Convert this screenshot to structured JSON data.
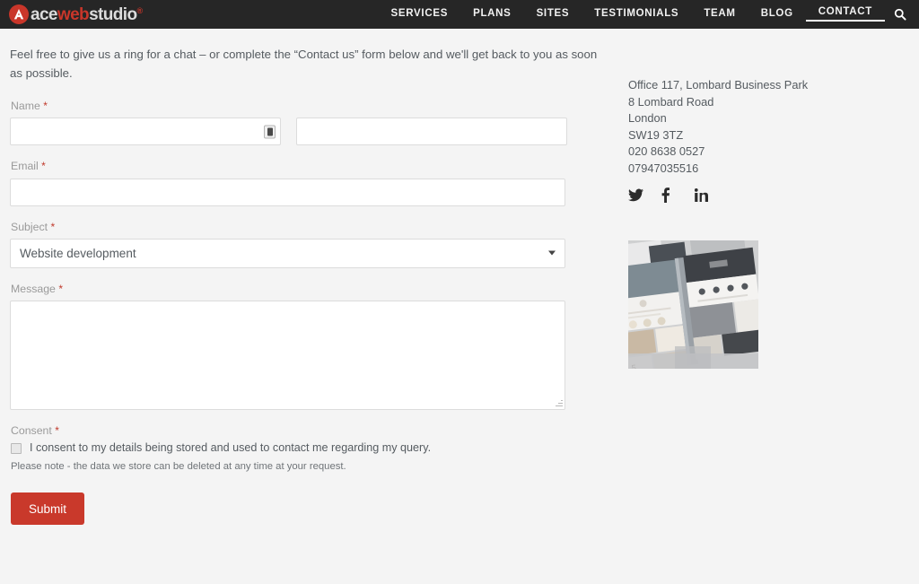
{
  "header": {
    "logo": {
      "mark_letter": "A",
      "part1": "ace",
      "part2": "web",
      "part3": "studio",
      "registered": "®",
      "brand_red": "#c9362a",
      "brand_light": "#dcdcdc",
      "bar_bg": "#262626"
    },
    "nav": [
      {
        "label": "SERVICES",
        "active": false
      },
      {
        "label": "PLANS",
        "active": false
      },
      {
        "label": "SITES",
        "active": false
      },
      {
        "label": "TESTIMONIALS",
        "active": false
      },
      {
        "label": "TEAM",
        "active": false
      },
      {
        "label": "BLOG",
        "active": false
      },
      {
        "label": "CONTACT",
        "active": true
      }
    ],
    "search_icon": "search-icon"
  },
  "main": {
    "intro": "Feel free to give us a ring for a chat – or complete the “Contact us” form below and we'll get back to you as soon as possible.",
    "fields": {
      "name": {
        "label": "Name",
        "required_mark": "*",
        "first_value": "",
        "last_value": "",
        "autofill_icon": "contact-card-icon"
      },
      "email": {
        "label": "Email",
        "required_mark": "*",
        "value": ""
      },
      "subject": {
        "label": "Subject",
        "required_mark": "*",
        "selected": "Website development",
        "options": [
          "Website development"
        ]
      },
      "message": {
        "label": "Message",
        "required_mark": "*",
        "value": ""
      },
      "consent": {
        "label": "Consent",
        "required_mark": "*",
        "checkbox_label": "I consent to my details being stored and used to contact me regarding my query.",
        "checked": false,
        "note": "Please note - the data we store can be deleted at any time at your request."
      }
    },
    "submit_label": "Submit",
    "submit_color": "#c9392b"
  },
  "sidebar": {
    "address": [
      "Office 117, Lombard Business Park",
      "8 Lombard Road",
      "London",
      "SW19 3TZ",
      "020 8638 0527",
      "07947035516"
    ],
    "socials": [
      {
        "name": "twitter-icon"
      },
      {
        "name": "facebook-icon"
      },
      {
        "name": "linkedin-icon"
      }
    ],
    "thumbnail_alt": "website-mockup-photo"
  }
}
